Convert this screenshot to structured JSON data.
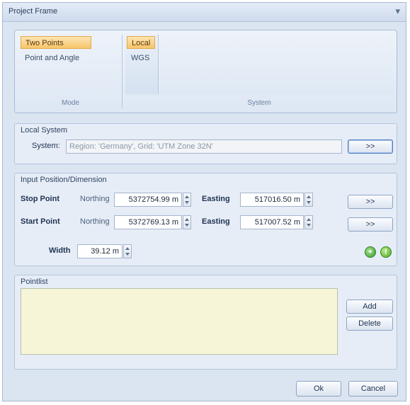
{
  "window": {
    "title": "Project Frame",
    "close_glyph": "▾"
  },
  "ribbon": {
    "mode": {
      "label": "Mode",
      "options": [
        "Two Points",
        "Point and Angle"
      ],
      "selected": "Two Points"
    },
    "system": {
      "label": "System",
      "options": [
        "Local",
        "WGS"
      ],
      "selected": "Local"
    }
  },
  "local_system": {
    "title": "Local System",
    "system_label": "System:",
    "system_value": "Region: 'Germany', Grid: 'UTM Zone 32N'",
    "browse_label": ">>"
  },
  "input_position": {
    "title": "Input Position/Dimension",
    "stop_point": {
      "label": "Stop Point",
      "northing_label": "Northing",
      "northing_value": "5372754.99 m",
      "easting_label": "Easting",
      "easting_value": "517016.50 m",
      "browse_label": ">>"
    },
    "start_point": {
      "label": "Start Point",
      "northing_label": "Northing",
      "northing_value": "5372769.13 m",
      "easting_label": "Easting",
      "easting_value": "517007.52 m",
      "browse_label": ">>"
    },
    "width_label": "Width",
    "width_value": "39.12 m"
  },
  "pointlist": {
    "title": "Pointlist",
    "add_label": "Add",
    "delete_label": "Delete"
  },
  "footer": {
    "ok_label": "Ok",
    "cancel_label": "Cancel"
  },
  "colors": {
    "selected_highlight": "#f7c56b",
    "window_background": "#dbe5f1",
    "pointlist_background": "#f7f5d8",
    "add_icon": "#3c9e2c"
  },
  "icons": {
    "add": "add-point-icon",
    "info": "info-icon"
  }
}
